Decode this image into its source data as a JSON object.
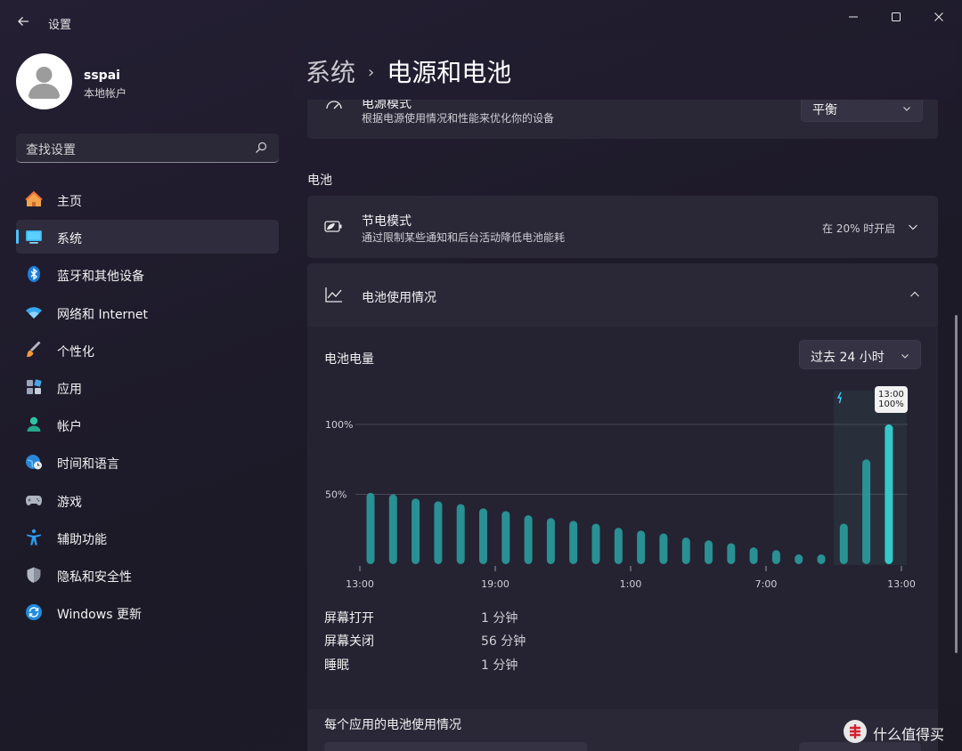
{
  "app": {
    "title": "设置"
  },
  "profile": {
    "name": "sspai",
    "account_type": "本地帐户"
  },
  "search": {
    "placeholder": "查找设置"
  },
  "nav": {
    "items": [
      {
        "label": "主页",
        "icon": "home-icon"
      },
      {
        "label": "系统",
        "icon": "system-icon",
        "active": true
      },
      {
        "label": "蓝牙和其他设备",
        "icon": "bluetooth-icon"
      },
      {
        "label": "网络和 Internet",
        "icon": "wifi-icon"
      },
      {
        "label": "个性化",
        "icon": "brush-icon"
      },
      {
        "label": "应用",
        "icon": "apps-icon"
      },
      {
        "label": "帐户",
        "icon": "account-icon"
      },
      {
        "label": "时间和语言",
        "icon": "globe-clock-icon"
      },
      {
        "label": "游戏",
        "icon": "gamepad-icon"
      },
      {
        "label": "辅助功能",
        "icon": "accessibility-icon"
      },
      {
        "label": "隐私和安全性",
        "icon": "shield-icon"
      },
      {
        "label": "Windows 更新",
        "icon": "update-icon"
      }
    ]
  },
  "breadcrumb": {
    "parent": "系统",
    "separator": "›",
    "current": "电源和电池"
  },
  "power_mode": {
    "title": "电源模式",
    "description": "根据电源使用情况和性能来优化你的设备",
    "value": "平衡"
  },
  "battery_section": {
    "label": "电池"
  },
  "battery_saver": {
    "title": "节电模式",
    "description": "通过限制某些通知和后台活动降低电池能耗",
    "status": "在 20% 时开启"
  },
  "battery_usage": {
    "title": "电池使用情况"
  },
  "battery_level": {
    "label": "电池电量",
    "range": "过去 24 小时"
  },
  "chart_data": {
    "type": "bar",
    "title": "电池电量",
    "x_ticks": [
      "13:00",
      "19:00",
      "1:00",
      "7:00",
      "13:00"
    ],
    "y_ticks": [
      "50%",
      "100%"
    ],
    "ylim": [
      0,
      100
    ],
    "values": [
      51,
      50,
      47,
      45,
      43,
      40,
      38,
      35,
      33,
      31,
      29,
      26,
      24,
      22,
      19,
      17,
      15,
      12,
      10,
      7,
      7,
      29,
      75,
      100
    ],
    "charging_segment_start_index": 21,
    "tooltip": {
      "time": "13:00",
      "value": "100%"
    },
    "colors": {
      "bar": "#2aa3a6",
      "bar_highlight": "#35c8c9",
      "grid": "#4a4757"
    }
  },
  "stats": [
    {
      "label": "屏幕打开",
      "value": "1 分钟"
    },
    {
      "label": "屏幕关闭",
      "value": "56 分钟"
    },
    {
      "label": "睡眠",
      "value": "1 分钟"
    }
  ],
  "per_app": {
    "title": "每个应用的电池使用情况"
  },
  "watermark": {
    "text": "什么值得买"
  },
  "colors": {
    "accent": "#4cc2ff",
    "background": "#1f1b2c",
    "card": "#2a2737"
  }
}
